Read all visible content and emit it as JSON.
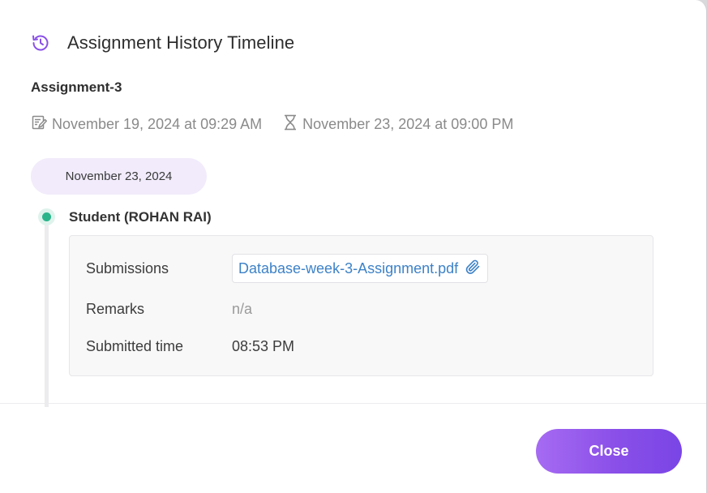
{
  "colors": {
    "accent": "#8a4fe8",
    "link": "#3d82c8",
    "timeline_dot": "#2bb48a",
    "pill_bg": "#f1ebfb"
  },
  "header": {
    "icon": "history-icon",
    "title": "Assignment History Timeline"
  },
  "assignment": {
    "name": "Assignment-3",
    "created_icon": "edit-document-icon",
    "created": "November 19, 2024 at 09:29 AM",
    "due_icon": "hourglass-icon",
    "due": "November 23, 2024 at 09:00 PM"
  },
  "timeline": {
    "date": "November 23, 2024",
    "entries": [
      {
        "actor": "Student (ROHAN RAI)",
        "fields": {
          "submissions_label": "Submissions",
          "submission_file": "Database-week-3-Assignment.pdf",
          "attachment_icon": "paperclip-icon",
          "remarks_label": "Remarks",
          "remarks_value": "n/a",
          "submitted_time_label": "Submitted time",
          "submitted_time_value": "08:53 PM"
        }
      }
    ]
  },
  "footer": {
    "close_label": "Close"
  }
}
